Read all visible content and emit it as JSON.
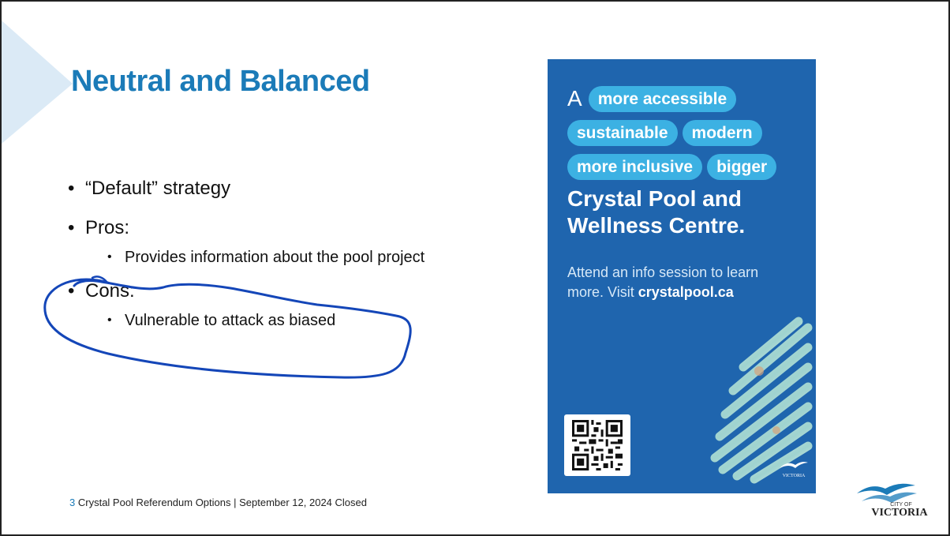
{
  "slide": {
    "title": "Neutral and Balanced",
    "bullets": [
      {
        "level": 1,
        "text": "“Default” strategy"
      },
      {
        "level": 1,
        "text": "Pros:"
      },
      {
        "level": 2,
        "text": "Provides information about the pool project"
      },
      {
        "level": 1,
        "text": "Cons:"
      },
      {
        "level": 2,
        "text": "Vulnerable to attack as biased"
      }
    ],
    "footer": {
      "page_number": "3",
      "text": "Crystal Pool Referendum Options | September 12, 2024 Closed"
    },
    "accent_color": "#1b7bb8",
    "ink_color": "#1446b8"
  },
  "poster": {
    "lead_letter": "A",
    "pills_row1": [
      "more accessible"
    ],
    "pills_row2": [
      "sustainable",
      "modern"
    ],
    "pills_row3": [
      "more inclusive",
      "bigger"
    ],
    "title": "Crystal Pool and Wellness Centre.",
    "body_text": "Attend an info session to learn more. Visit ",
    "body_link": "crystalpool.ca",
    "logo_text": "VICTORIA",
    "background_color": "#1f65ae",
    "pill_color": "#3cb1e3",
    "qr_icon": "qr-code-icon",
    "photo_icon": "swimmers-photo-stripes"
  },
  "logo": {
    "small_text": "CITY OF",
    "name": "VICTORIA"
  }
}
